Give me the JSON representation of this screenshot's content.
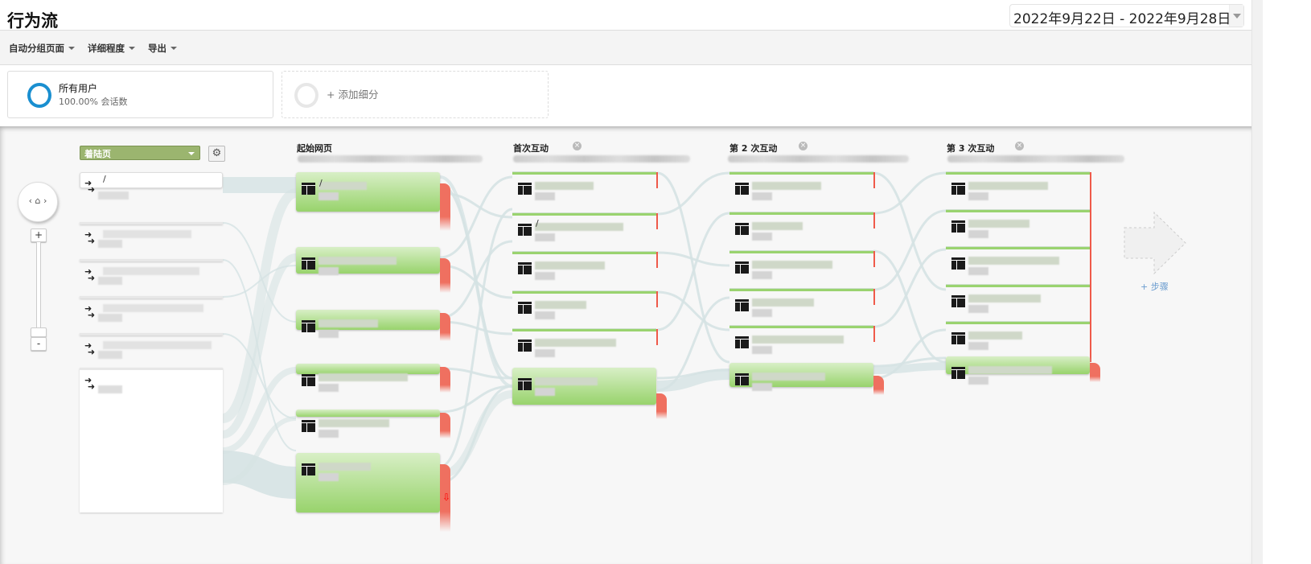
{
  "header": {
    "title": "行为流",
    "date_range": "2022年9月22日 - 2022年9月28日"
  },
  "toolbar": {
    "group_pages": "自动分组页面",
    "detail_level": "详细程度",
    "export": "导出"
  },
  "segments": {
    "all_users": "所有用户",
    "all_users_pct": "100.00% 会话数",
    "add_segment": "+ 添加细分"
  },
  "flow": {
    "dimension_select": "着陆页",
    "columns": [
      {
        "title": "起始网页",
        "first_label": "/"
      },
      {
        "title": "首次互动",
        "second_label": "/"
      },
      {
        "title": "第 2 次互动"
      },
      {
        "title": "第 3 次互动"
      }
    ],
    "landing_first_label": "/",
    "add_step": "+ 步骤",
    "colors": {
      "node": "#98d36c",
      "dropoff": "#ef7060",
      "flow": "#d5e2e3",
      "segment": "#1a8fd0"
    }
  }
}
